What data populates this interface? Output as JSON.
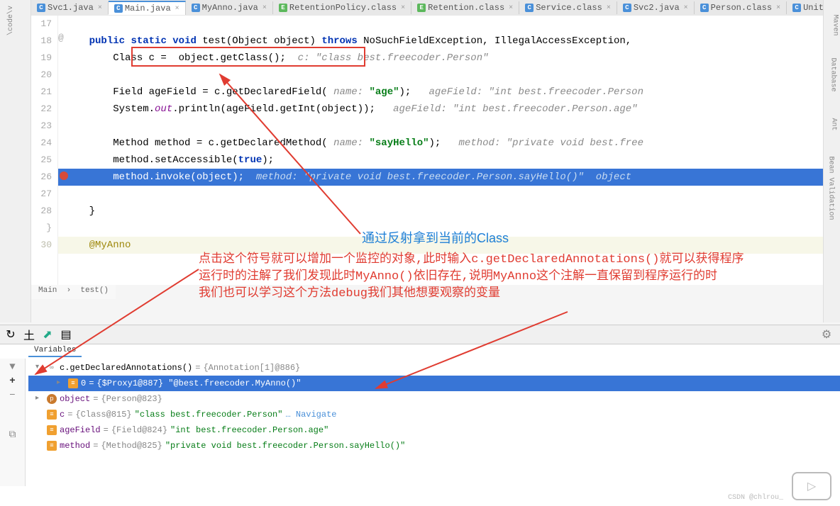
{
  "tabs": [
    {
      "icon": "C",
      "label": "Svc1.java",
      "active": false
    },
    {
      "icon": "C",
      "label": "Main.java",
      "active": true
    },
    {
      "icon": "C",
      "label": "MyAnno.java",
      "active": false
    },
    {
      "icon": "E",
      "label": "RetentionPolicy.class",
      "active": false
    },
    {
      "icon": "E",
      "label": "Retention.class",
      "active": false
    },
    {
      "icon": "C",
      "label": "Service.class",
      "active": false
    },
    {
      "icon": "C",
      "label": "Svc2.java",
      "active": false
    },
    {
      "icon": "C",
      "label": "Person.class",
      "active": false
    },
    {
      "icon": "C",
      "label": "Unittestd",
      "active": false
    }
  ],
  "left_sidebar": "\\code\\v",
  "right_sidebar": [
    "Maven",
    "Database",
    "Ant",
    "Bean Validation"
  ],
  "gutter": [
    "17",
    "18",
    "19",
    "20",
    "21",
    "22",
    "23",
    "24",
    "25",
    "26",
    "27",
    "28  }",
    "",
    "30"
  ],
  "line18_at": "@",
  "code": {
    "l18": {
      "pre": "    ",
      "kw1": "public",
      "sp1": " ",
      "kw2": "static",
      "sp2": " ",
      "kw3": "void",
      "sp3": " ",
      "fn": "test(Object object) ",
      "kw4": "throws",
      "rest": " NoSuchFieldException, IllegalAccessException,"
    },
    "l19": {
      "indent": "        ",
      "text": "Class c =  object.getClass();",
      "comment": "  c: \"class best.freecoder.Person\""
    },
    "l21": {
      "indent": "        ",
      "p1": "Field ageField = c.getDeclaredField( ",
      "param": "name: ",
      "str": "\"age\"",
      "p2": ");",
      "comment": "   ageField: \"int best.freecoder.Person"
    },
    "l22": {
      "indent": "        ",
      "p1": "System.",
      "ital": "out",
      "p2": ".println(ageField.getInt(object));",
      "comment": "   ageField: \"int best.freecoder.Person.age\""
    },
    "l24": {
      "indent": "        ",
      "p1": "Method method = c.getDeclaredMethod( ",
      "param": "name: ",
      "str": "\"sayHello\"",
      "p2": ");",
      "comment": "   method: \"private void best.free"
    },
    "l25": {
      "indent": "        ",
      "p1": "method.setAccessible(",
      "kw": "true",
      "p2": ");"
    },
    "l26": {
      "indent": "        ",
      "p1": "method.invoke(object); ",
      "comment": " method: \"private void best.freecoder.Person.sayHello()\"  object"
    },
    "l28": "    }",
    "l30": "    @MyAnno"
  },
  "breadcrumb": {
    "a": "Main",
    "b": "test()"
  },
  "anno_blue": "通过反射拿到当前的Class",
  "anno_red_1": "点击这个符号就可以增加一个监控的对象,此时输入c.getDeclaredAnnotations()就可以获得程序",
  "anno_red_2": "运行时的注解了我们发现此时MyAnno()依旧存在,说明MyAnno这个注解一直保留到程序运行的时",
  "anno_red_3": "我们也可以学习这个方法debug我们其他想要观察的变量",
  "debug": {
    "tab": "Variables",
    "rows": [
      {
        "depth": 0,
        "arrow": "▾",
        "icon": "∞",
        "name": "c.getDeclaredAnnotations()",
        "eq": " = ",
        "val": "{Annotation[1]@886}"
      },
      {
        "depth": 1,
        "arrow": "▸",
        "icon": "≡",
        "name": "0",
        "eq": " = ",
        "val": "{$Proxy1@887} \"@best.freecoder.MyAnno()\"",
        "selected": true
      },
      {
        "depth": 0,
        "arrow": "▸",
        "icon": "p",
        "name": "object",
        "eq": " = ",
        "val": "{Person@823}"
      },
      {
        "depth": 0,
        "arrow": "",
        "icon": "≡",
        "name": "c",
        "eq": " = ",
        "val": "{Class@815}",
        "str": " \"class best.freecoder.Person\"",
        "nav": "… Navigate"
      },
      {
        "depth": 0,
        "arrow": "",
        "icon": "≡",
        "name": "ageField",
        "eq": " = ",
        "val": "{Field@824}",
        "str": " \"int best.freecoder.Person.age\""
      },
      {
        "depth": 0,
        "arrow": "",
        "icon": "≡",
        "name": "method",
        "eq": " = ",
        "val": "{Method@825}",
        "str": " \"private void best.freecoder.Person.sayHello()\""
      }
    ]
  },
  "watermark": "CSDN @chlrou_"
}
